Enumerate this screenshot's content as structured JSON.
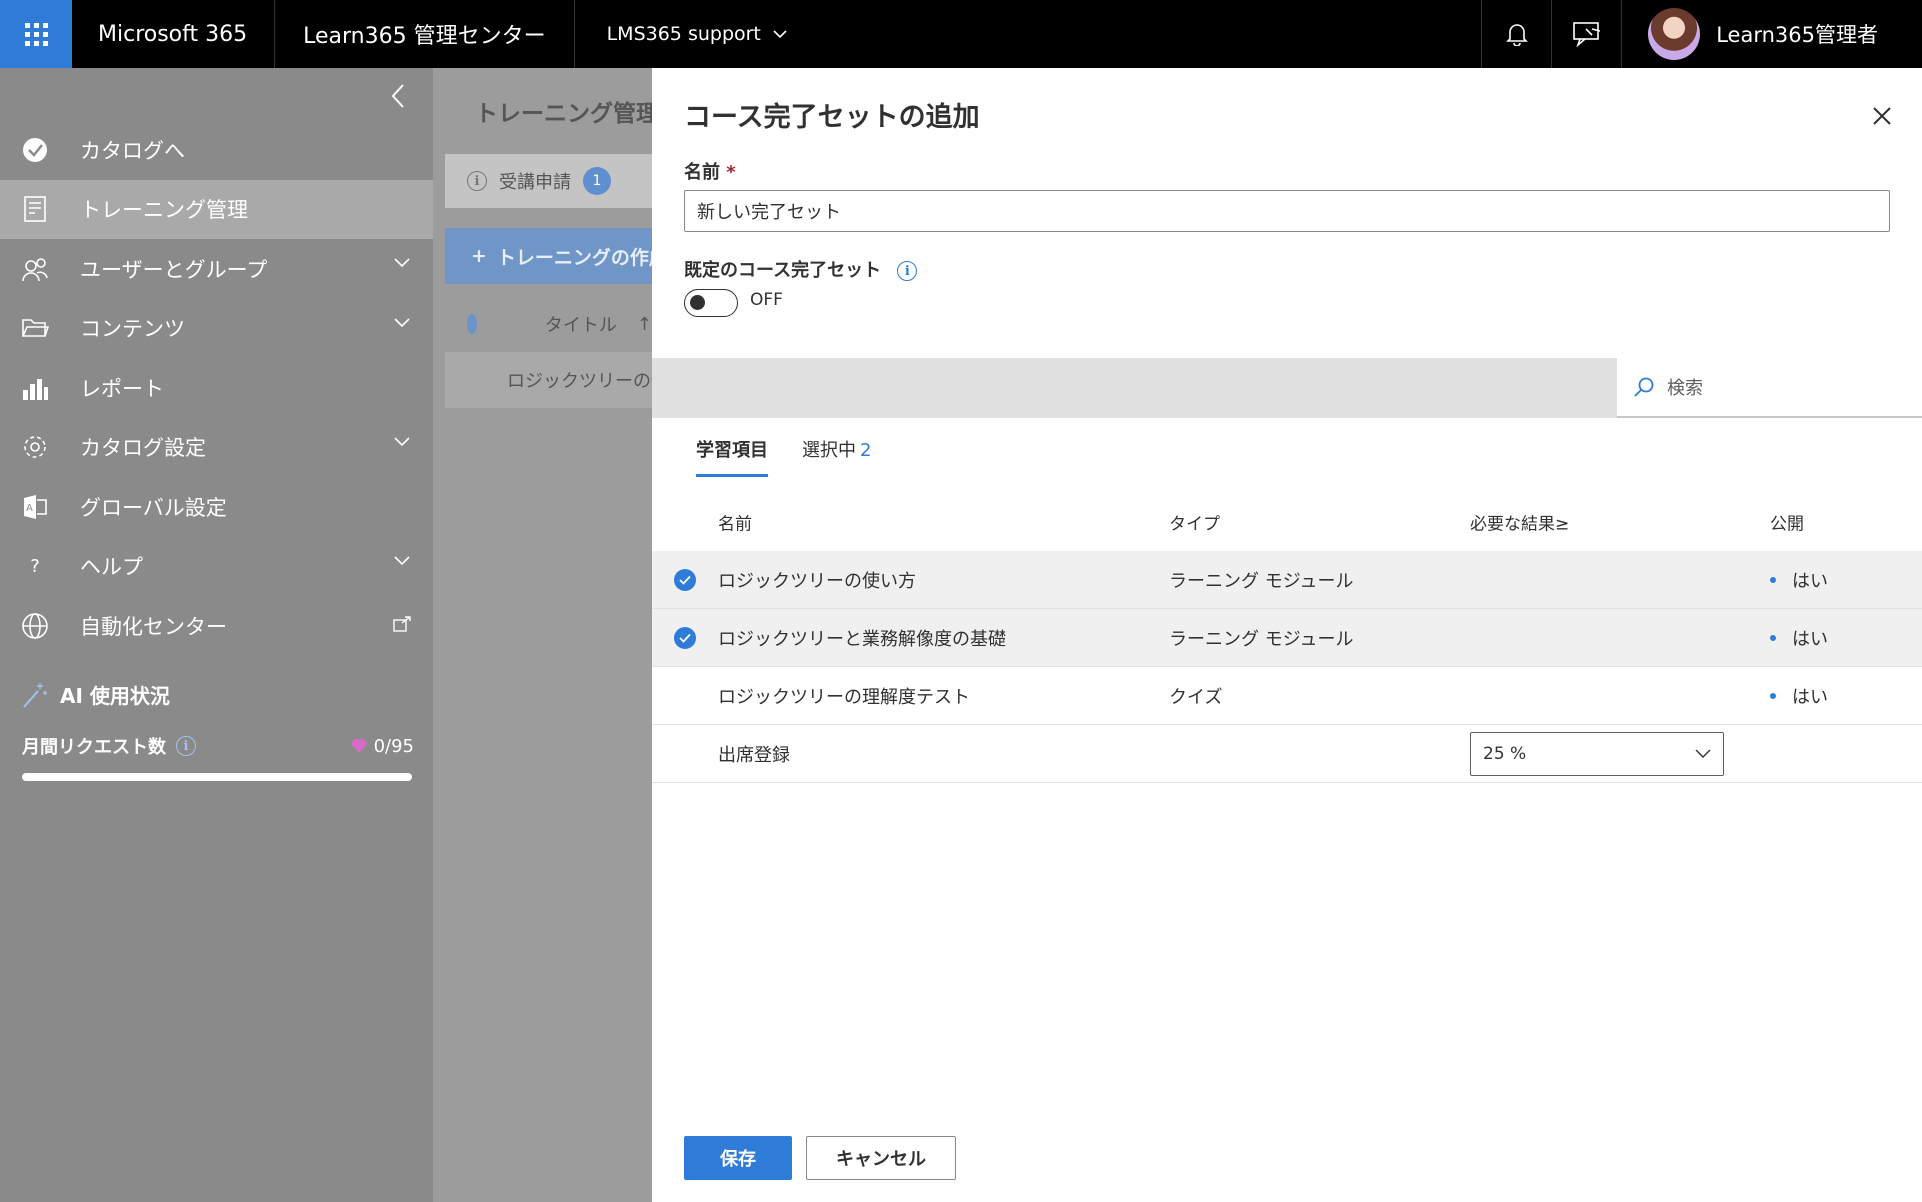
{
  "topbar": {
    "suite": "Microsoft 365",
    "center": "Learn365 管理センター",
    "tenant": "LMS365 support",
    "user": "Learn365管理者",
    "icons": [
      "waffle-icon",
      "bell-icon",
      "feedback-icon",
      "avatar"
    ]
  },
  "sidebar": {
    "items": [
      {
        "label": "カタログへ",
        "icon": "catalog-check-icon"
      },
      {
        "label": "トレーニング管理",
        "icon": "document-icon"
      },
      {
        "label": "ユーザーとグループ",
        "icon": "people-icon"
      },
      {
        "label": "コンテンツ",
        "icon": "folder-icon"
      },
      {
        "label": "レポート",
        "icon": "bar-chart-icon"
      },
      {
        "label": "カタログ設定",
        "icon": "gear-icon"
      },
      {
        "label": "グローバル設定",
        "icon": "translate-icon"
      },
      {
        "label": "ヘルプ",
        "icon": "help-icon"
      },
      {
        "label": "自動化センター",
        "icon": "globe-icon"
      }
    ],
    "ai_title": "AI 使用状況",
    "ai_requests_label": "月間リクエスト数",
    "ai_requests_count": "0/95",
    "ai_requests_used_fraction": 0
  },
  "background": {
    "title": "トレーニング管理",
    "tab_label": "受講申請",
    "tab_badge": "1",
    "create_label": "トレーニングの作成",
    "col_title": "タイトル",
    "row1": "ロジックツリーの使い方"
  },
  "panel": {
    "title": "コース完了セットの追加",
    "name_label": "名前",
    "required_mark": "*",
    "name_value": "新しい完了セット",
    "default_label": "既定のコース完了セット",
    "toggle_state": "OFF",
    "search_placeholder": "検索",
    "tabs": [
      {
        "label": "学習項目",
        "count": ""
      },
      {
        "label": "選択中",
        "count": "2"
      }
    ],
    "columns": [
      "名前",
      "タイプ",
      "必要な結果≥",
      "公開"
    ],
    "rows": [
      {
        "name": "ロジックツリーの使い方",
        "type": "ラーニング モジュール",
        "result": "",
        "published": "はい",
        "selected": true
      },
      {
        "name": "ロジックツリーと業務解像度の基礎",
        "type": "ラーニング モジュール",
        "result": "",
        "published": "はい",
        "selected": true
      },
      {
        "name": "ロジックツリーの理解度テスト",
        "type": "クイズ",
        "result": "",
        "published": "はい",
        "selected": false
      },
      {
        "name": "出席登録",
        "type": "",
        "result": "25 %",
        "published": "",
        "selected": false
      }
    ],
    "save_label": "保存",
    "cancel_label": "キャンセル"
  }
}
